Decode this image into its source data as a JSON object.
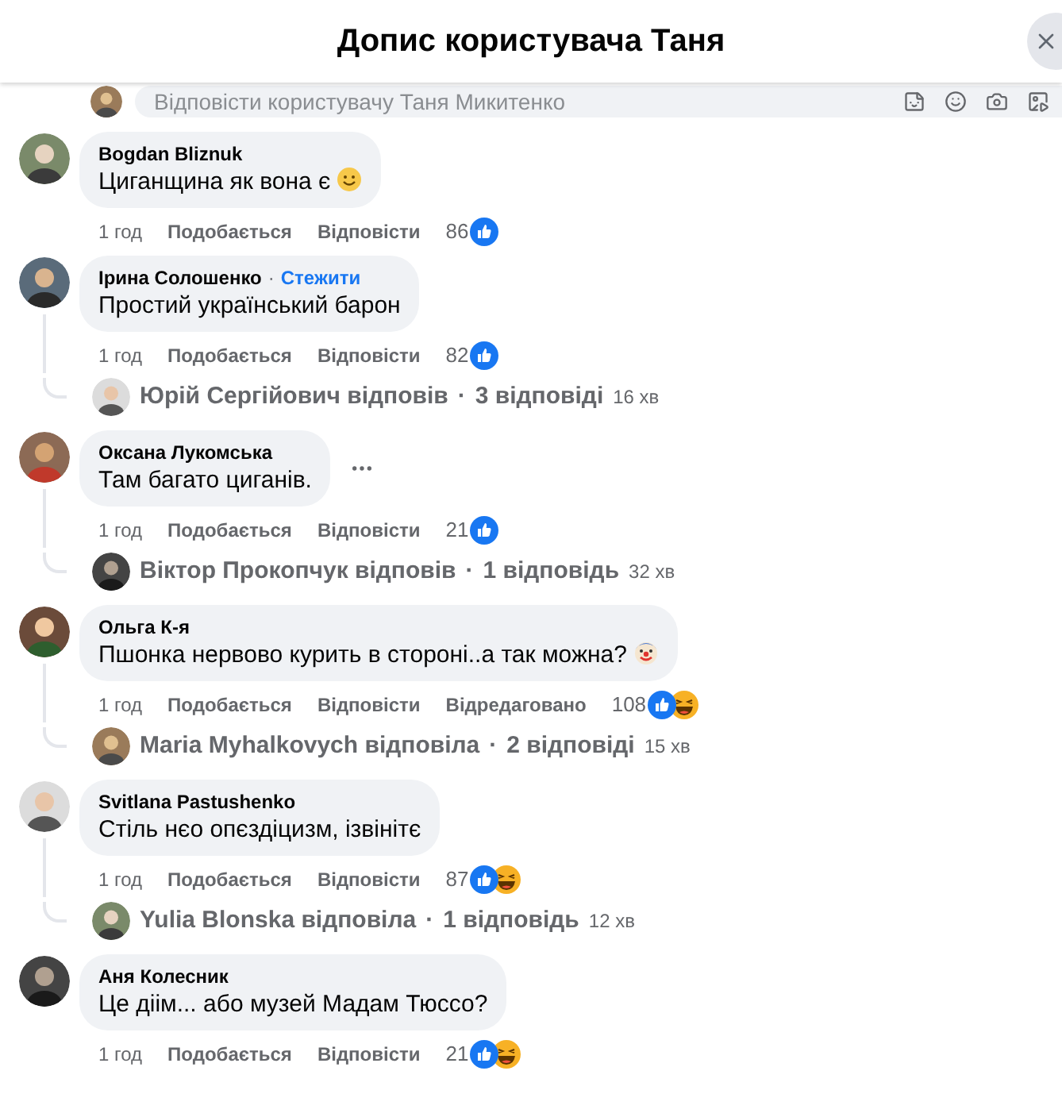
{
  "header": {
    "title": "Допис користувача Таня"
  },
  "reply_field": {
    "placeholder": "Відповісти користувачу Таня Микитенко"
  },
  "comments": [
    {
      "author": "Bogdan Bliznuk",
      "text": "Циганщина як вона є",
      "emoji": {
        "kind": "smile"
      },
      "time": "1 год",
      "like": "Подобається",
      "reply": "Відповісти",
      "count": "86",
      "reactions": [
        {
          "kind": "like"
        }
      ]
    },
    {
      "author": "Ірина Солошенко",
      "separator": "·",
      "follow": "Стежити",
      "text": "Простий український барон",
      "time": "1 год",
      "like": "Подобається",
      "reply": "Відповісти",
      "count": "82",
      "reactions": [
        {
          "kind": "like"
        }
      ],
      "replies": {
        "author": "Юрій Сергійович відповів",
        "separator": "·",
        "count": "3 відповіді",
        "time": "16 хв"
      }
    },
    {
      "author": "Оксана Лукомська",
      "text": "Там багато циганів.",
      "menu_shown": true,
      "time": "1 год",
      "like": "Подобається",
      "reply": "Відповісти",
      "count": "21",
      "reactions": [
        {
          "kind": "like"
        }
      ],
      "replies": {
        "author": "Віктор Прокопчук відповів",
        "separator": "·",
        "count": "1 відповідь",
        "time": "32 хв"
      }
    },
    {
      "author": "Ольга К-я",
      "text": "Пшонка нервово курить в стороні..а так можна?",
      "emoji": {
        "kind": "clown"
      },
      "time": "1 год",
      "like": "Подобається",
      "reply": "Відповісти",
      "edited": "Відредаговано",
      "count": "108",
      "reactions": [
        {
          "kind": "like"
        },
        {
          "kind": "haha"
        }
      ],
      "replies": {
        "author": "Maria Myhalkovych відповіла",
        "separator": "·",
        "count": "2 відповіді",
        "time": "15 хв"
      }
    },
    {
      "author": "Svitlana Pastushenko",
      "text": "Стіль нєо опєздіцизм, ізвінітє",
      "time": "1 год",
      "like": "Подобається",
      "reply": "Відповісти",
      "count": "87",
      "reactions": [
        {
          "kind": "like"
        },
        {
          "kind": "haha"
        }
      ],
      "replies": {
        "author": "Yulia Blonska відповіла",
        "separator": "·",
        "count": "1 відповідь",
        "time": "12 хв"
      }
    },
    {
      "author": "Аня Колесник",
      "text": "Це діім... або музей Мадам Тюссо?",
      "time": "1 год",
      "like": "Подобається",
      "reply": "Відповісти",
      "count": "21",
      "reactions": [
        {
          "kind": "like"
        },
        {
          "kind": "haha"
        }
      ]
    }
  ]
}
